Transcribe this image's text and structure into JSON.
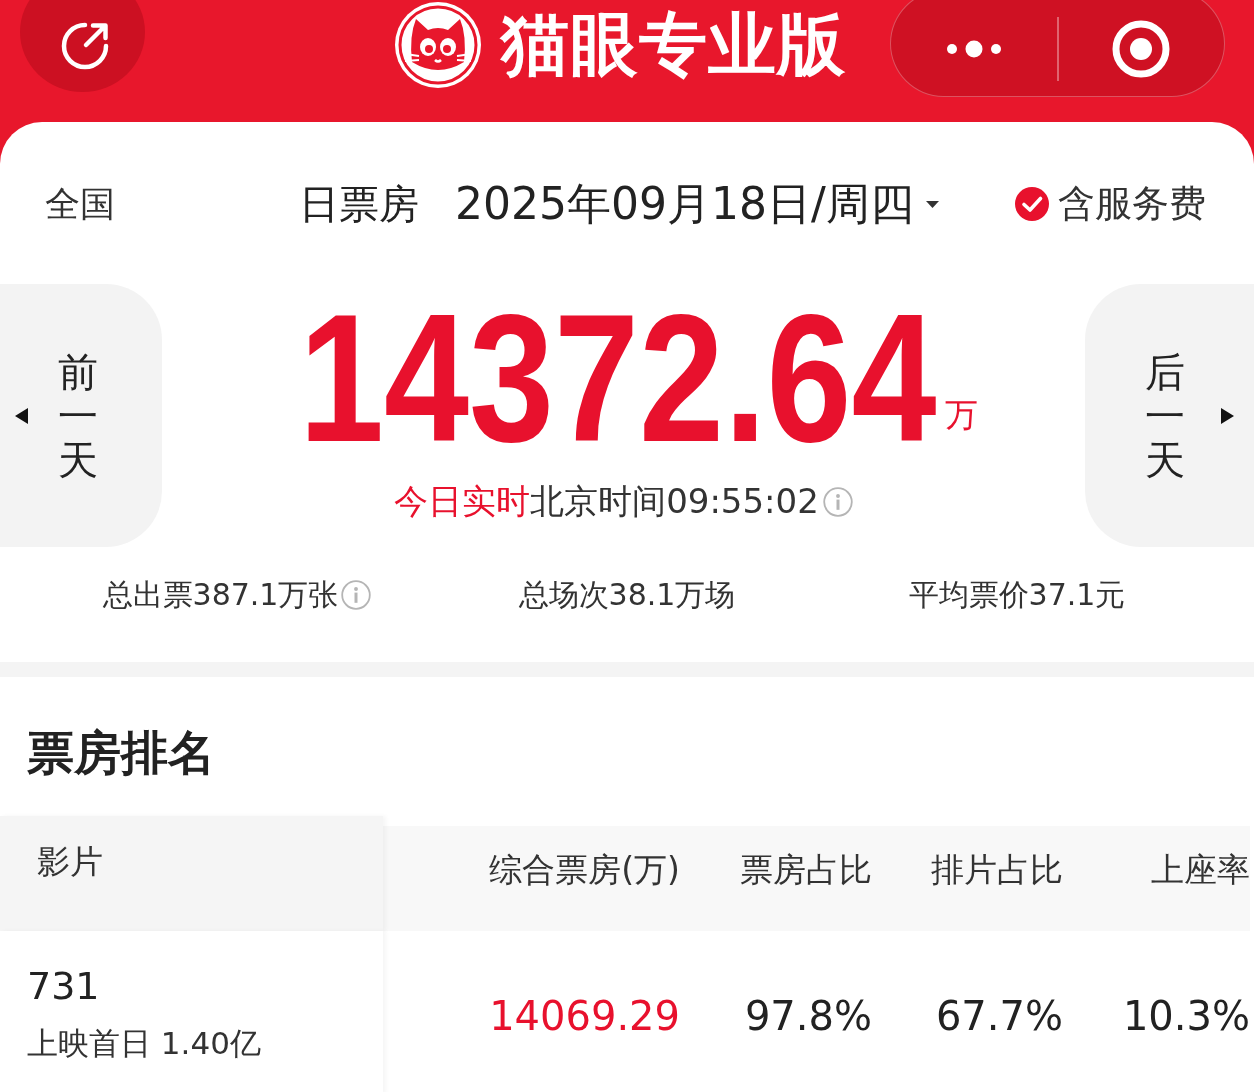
{
  "top_bar": {
    "title": "猫眼专业版"
  },
  "header": {
    "region": "全国",
    "mode": "日票房",
    "date": "2025年09月18日/周四",
    "service_fee": {
      "label": "含服务费",
      "checked": true
    }
  },
  "summary": {
    "prev_day": "前一天",
    "next_day": "后一天",
    "box_office": "14372.64",
    "unit": "万",
    "status": "今日实时",
    "time": "北京时间09:55:02"
  },
  "stats": [
    {
      "text": "总出票387.1万张",
      "info": true
    },
    {
      "text": "总场次38.1万场",
      "info": false
    },
    {
      "text": "平均票价37.1元",
      "info": false
    }
  ],
  "ranking": {
    "title": "票房排名",
    "columns": [
      "影片",
      "综合票房(万)",
      "票房占比",
      "排片占比",
      "上座率"
    ],
    "rows": [
      {
        "movie": "731",
        "note": "上映首日 1.40亿",
        "box_office": "14069.29",
        "box_office_share": "97.8%",
        "screening_share": "67.7%",
        "occupancy": "10.3%"
      }
    ]
  }
}
